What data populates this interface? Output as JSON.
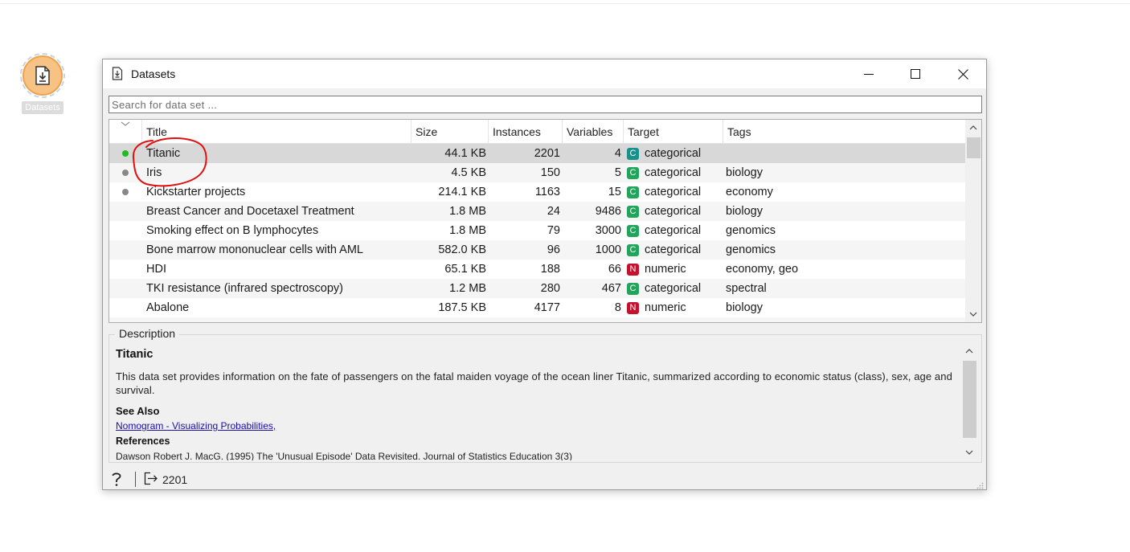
{
  "canvas": {
    "widget_label": "Datasets"
  },
  "window": {
    "title": "Datasets"
  },
  "search": {
    "placeholder": "Search for data set ..."
  },
  "table": {
    "headers": {
      "title": "Title",
      "size": "Size",
      "instances": "Instances",
      "variables": "Variables",
      "target": "Target",
      "tags": "Tags"
    },
    "rows": [
      {
        "status": "loaded",
        "title": "Titanic",
        "size": "44.1 KB",
        "instances": "2201",
        "variables": "4",
        "target_badge": "C",
        "target": "categorical",
        "tags": ""
      },
      {
        "status": "local",
        "title": "Iris",
        "size": "4.5 KB",
        "instances": "150",
        "variables": "5",
        "target_badge": "C",
        "target": "categorical",
        "tags": "biology"
      },
      {
        "status": "local",
        "title": "Kickstarter projects",
        "size": "214.1 KB",
        "instances": "1163",
        "variables": "15",
        "target_badge": "C",
        "target": "categorical",
        "tags": "economy"
      },
      {
        "status": "",
        "title": "Breast Cancer and Docetaxel Treatment",
        "size": "1.8 MB",
        "instances": "24",
        "variables": "9486",
        "target_badge": "C",
        "target": "categorical",
        "tags": "biology"
      },
      {
        "status": "",
        "title": "Smoking effect on B lymphocytes",
        "size": "1.8 MB",
        "instances": "79",
        "variables": "3000",
        "target_badge": "C",
        "target": "categorical",
        "tags": "genomics"
      },
      {
        "status": "",
        "title": "Bone marrow mononuclear cells with AML",
        "size": "582.0 KB",
        "instances": "96",
        "variables": "1000",
        "target_badge": "C",
        "target": "categorical",
        "tags": "genomics"
      },
      {
        "status": "",
        "title": "HDI",
        "size": "65.1 KB",
        "instances": "188",
        "variables": "66",
        "target_badge": "N",
        "target": "numeric",
        "tags": "economy, geo"
      },
      {
        "status": "",
        "title": "TKI resistance (infrared spectroscopy)",
        "size": "1.2 MB",
        "instances": "280",
        "variables": "467",
        "target_badge": "C",
        "target": "categorical",
        "tags": "spectral"
      },
      {
        "status": "",
        "title": "Abalone",
        "size": "187.5 KB",
        "instances": "4177",
        "variables": "8",
        "target_badge": "N",
        "target": "numeric",
        "tags": "biology"
      }
    ]
  },
  "description": {
    "legend": "Description",
    "title": "Titanic",
    "text": "This data set provides information on the fate of passengers on the fatal maiden voyage of the ocean liner Titanic, summarized according to economic status (class), sex, age and survival.",
    "see_also_label": "See Also",
    "see_also_link": "Nomogram - Visualizing Probabilities",
    "references_label": "References",
    "reference_text": "Dawson Robert J. MacG. (1995) The 'Unusual Episode' Data Revisited. Journal of Statistics Education 3(3)"
  },
  "status": {
    "output_count": "2201"
  },
  "colors": {
    "badge_categorical": "#1fa65b",
    "badge_categorical_selected": "#17918c",
    "badge_numeric": "#c8102e",
    "dot_loaded": "#22bb22",
    "dot_local": "#888888",
    "selection": "#d8d8d8",
    "annotation": "#e01010"
  }
}
